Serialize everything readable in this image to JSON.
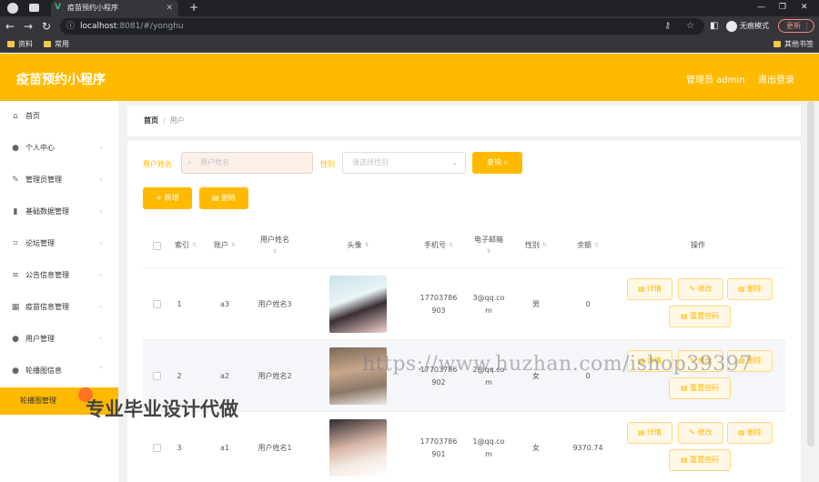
{
  "browser": {
    "tab_title": "疫苗预约小程序",
    "url_host": "localhost",
    "url_rest": ":8081/#/yonghu",
    "incognito_label": "无痕模式",
    "update_label": "更新",
    "bookmarks": [
      "资料",
      "常用"
    ],
    "other_bookmarks": "其他书签"
  },
  "header": {
    "title": "疫苗预约小程序",
    "user_label": "管理员 admin",
    "logout_label": "退出登录"
  },
  "sidebar": {
    "items": [
      {
        "label": "首页",
        "icon": "home-icon"
      },
      {
        "label": "个人中心",
        "icon": "user-icon"
      },
      {
        "label": "管理员管理",
        "icon": "edit-icon"
      },
      {
        "label": "基础数据管理",
        "icon": "chart-icon"
      },
      {
        "label": "论坛管理",
        "icon": "crop-icon"
      },
      {
        "label": "公告信息管理",
        "icon": "list-icon"
      },
      {
        "label": "疫苗信息管理",
        "icon": "grid-icon"
      },
      {
        "label": "用户管理",
        "icon": "user-icon"
      },
      {
        "label": "轮播图信息",
        "icon": "user-icon"
      }
    ],
    "active_sub": "轮播图管理"
  },
  "breadcrumb": {
    "home": "首页",
    "current": "用户"
  },
  "filters": {
    "name_label": "用户姓名",
    "name_placeholder": "用户姓名",
    "gender_label": "性别",
    "gender_placeholder": "请选择性别",
    "search_label": "查询"
  },
  "actions": {
    "add_label": "新增",
    "delete_label": "删除"
  },
  "table": {
    "columns": [
      "索引",
      "账户",
      "用户姓名",
      "头像",
      "手机号",
      "电子邮箱",
      "性别",
      "余额",
      "操作"
    ],
    "rows": [
      {
        "index": "1",
        "account": "a3",
        "name": "用户姓名3",
        "phone": [
          "17703786",
          "903"
        ],
        "email": [
          "3@qq.co",
          "m"
        ],
        "gender": "男",
        "balance": "0"
      },
      {
        "index": "2",
        "account": "a2",
        "name": "用户姓名2",
        "phone": [
          "17703786",
          "902"
        ],
        "email": [
          "2@qq.co",
          "m"
        ],
        "gender": "女",
        "balance": "0"
      },
      {
        "index": "3",
        "account": "a1",
        "name": "用户姓名1",
        "phone": [
          "17703786",
          "901"
        ],
        "email": [
          "1@qq.co",
          "m"
        ],
        "gender": "女",
        "balance": "9370.74"
      }
    ],
    "row_actions": {
      "detail": "详情",
      "edit": "修改",
      "delete": "删除",
      "reset": "重置密码"
    }
  },
  "watermark": "https://www.huzhan.com/ishop39397",
  "overlay_text": "专业毕业设计代做"
}
